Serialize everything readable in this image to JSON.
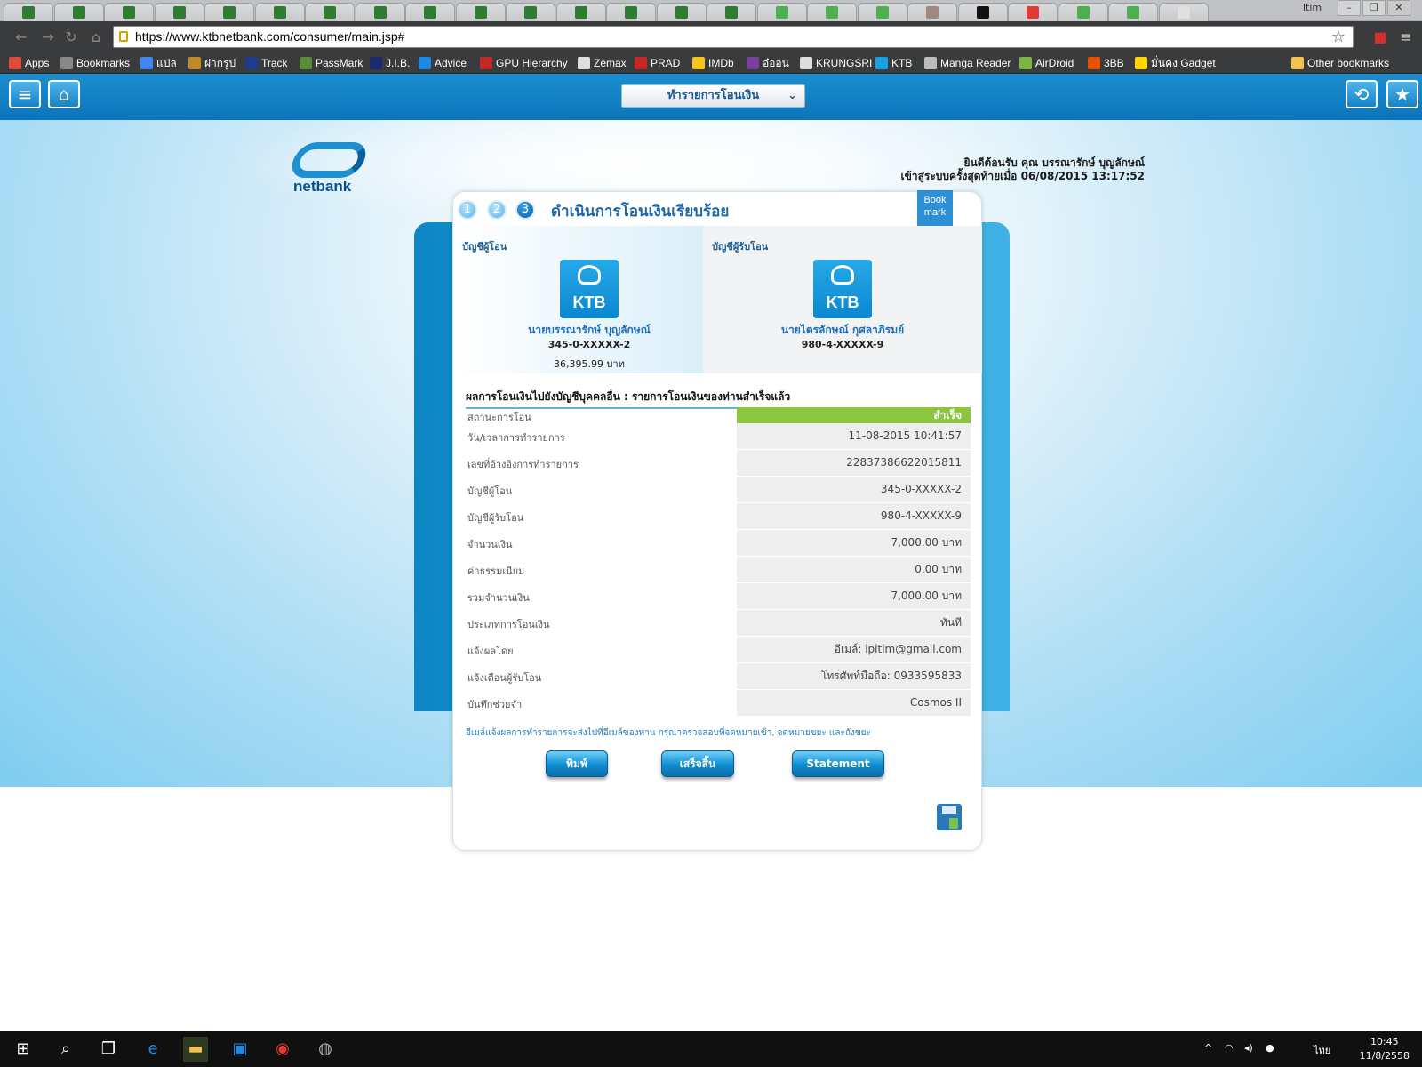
{
  "browser": {
    "window_user": "ltim",
    "window_controls": [
      "–",
      "❐",
      "✕"
    ],
    "url": "https://www.ktbnetbank.com/consumer/main.jsp#",
    "bookmarks": [
      {
        "label": "Apps",
        "color": "#e04b3a"
      },
      {
        "label": "Bookmarks",
        "color": "#888888"
      },
      {
        "label": "แปล",
        "color": "#4285f4"
      },
      {
        "label": "ฝากรูป",
        "color": "#c08a2a"
      },
      {
        "label": "Track",
        "color": "#1d3c8f"
      },
      {
        "label": "PassMark",
        "color": "#5a8c3c"
      },
      {
        "label": "J.I.B.",
        "color": "#1c2a6e"
      },
      {
        "label": "Advice",
        "color": "#1e88e5"
      },
      {
        "label": "GPU Hierarchy",
        "color": "#c62828"
      },
      {
        "label": "Zemax",
        "color": "#dddddd"
      },
      {
        "label": "PRAD",
        "color": "#c62828"
      },
      {
        "label": "IMDb",
        "color": "#f5c518"
      },
      {
        "label": "อ๋ออน",
        "color": "#7b3fa0"
      },
      {
        "label": "KRUNGSRI",
        "color": "#dddddd"
      },
      {
        "label": "KTB",
        "color": "#1ba1e2"
      },
      {
        "label": "Manga Reader",
        "color": "#bbbbbb"
      },
      {
        "label": "AirDroid",
        "color": "#7cb342"
      },
      {
        "label": "3BB",
        "color": "#e65100"
      },
      {
        "label": "มั่นคง Gadget",
        "color": "#ffd600"
      },
      {
        "label": "Other bookmarks",
        "color": "#f2c14e"
      }
    ]
  },
  "header": {
    "menu_label": "ทำรายการโอนเงิน",
    "welcome_line1": "ยินดีต้อนรับ คุณ บรรณารักษ์ บุญลักษณ์",
    "welcome_line2": "เข้าสู่ระบบครั้งสุดท้ายเมื่อ 06/08/2015 13:17:52",
    "logo_text": "netbank"
  },
  "card": {
    "steps": [
      "1",
      "2",
      "3"
    ],
    "title": "ดำเนินการโอนเงินเรียบร้อย",
    "bookmark_ribbon": "Book mark",
    "from": {
      "label": "บัญชีผู้โอน",
      "bank": "KTB",
      "name": "นายบรรณารักษ์ บุญลักษณ์",
      "account": "345-0-XXXXX-2",
      "balance": "36,395.99 บาท"
    },
    "to": {
      "label": "บัญชีผู้รับโอน",
      "bank": "KTB",
      "name": "นายไตรลักษณ์ กุศลาภิรมย์",
      "account": "980-4-XXXXX-9"
    },
    "result_heading": "ผลการโอนเงินไปยังบัญชีบุคคลอื่น : รายการโอนเงินของท่านสำเร็จแล้ว",
    "rows": [
      {
        "key": "สถานะการโอน",
        "value": "สำเร็จ"
      },
      {
        "key": "วัน/เวลาการทำรายการ",
        "value": "11-08-2015 10:41:57"
      },
      {
        "key": "เลขที่อ้างอิงการทำรายการ",
        "value": "22837386622015811"
      },
      {
        "key": "บัญชีผู้โอน",
        "value": "345-0-XXXXX-2"
      },
      {
        "key": "บัญชีผู้รับโอน",
        "value": "980-4-XXXXX-9"
      },
      {
        "key": "จำนวนเงิน",
        "value": "7,000.00 บาท"
      },
      {
        "key": "ค่าธรรมเนียม",
        "value": "0.00 บาท"
      },
      {
        "key": "รวมจำนวนเงิน",
        "value": "7,000.00 บาท"
      },
      {
        "key": "ประเภทการโอนเงิน",
        "value": "ทันที"
      },
      {
        "key": "แจ้งผลโดย",
        "value": "อีเมล์: ipitim@gmail.com"
      },
      {
        "key": "แจ้งเตือนผู้รับโอน",
        "value": "โทรศัพท์มือถือ: 0933595833"
      },
      {
        "key": "บันทึกช่วยจำ",
        "value": "Cosmos II"
      }
    ],
    "note": "อีเมล์แจ้งผลการทำรายการจะส่งไปที่อีเมล์ของท่าน กรุณาตรวจสอบที่จดหมายเข้า, จดหมายขยะ และถังขยะ",
    "buttons": {
      "print": "พิมพ์",
      "finish": "เสร็จสิ้น",
      "statement": "Statement"
    }
  },
  "taskbar": {
    "clock_time": "10:45",
    "clock_date": "11/8/2558",
    "language": "ไทย"
  }
}
